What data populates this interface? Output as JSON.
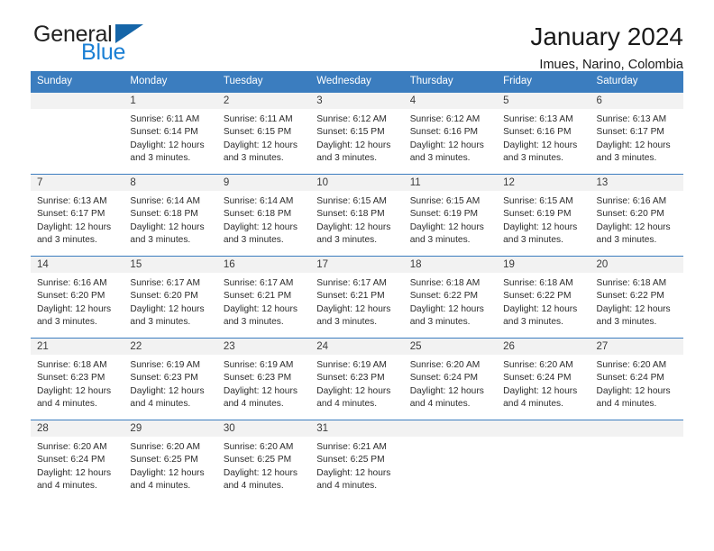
{
  "brand": {
    "name_part1": "General",
    "name_part2": "Blue",
    "triangle_icon": "triangle-icon",
    "accent_color": "#1a7fd4",
    "header_color": "#3b7dbf"
  },
  "header": {
    "title": "January 2024",
    "subtitle": "Imues, Narino, Colombia"
  },
  "weekday_headers": [
    "Sunday",
    "Monday",
    "Tuesday",
    "Wednesday",
    "Thursday",
    "Friday",
    "Saturday"
  ],
  "labels": {
    "sunrise": "Sunrise:",
    "sunset": "Sunset:",
    "daylight": "Daylight:"
  },
  "weeks": [
    [
      {
        "day": "",
        "empty": true,
        "sunrise": "",
        "sunset": "",
        "daylight_line1": "",
        "daylight_line2": ""
      },
      {
        "day": "1",
        "sunrise": "Sunrise: 6:11 AM",
        "sunset": "Sunset: 6:14 PM",
        "daylight_line1": "Daylight: 12 hours",
        "daylight_line2": "and 3 minutes."
      },
      {
        "day": "2",
        "sunrise": "Sunrise: 6:11 AM",
        "sunset": "Sunset: 6:15 PM",
        "daylight_line1": "Daylight: 12 hours",
        "daylight_line2": "and 3 minutes."
      },
      {
        "day": "3",
        "sunrise": "Sunrise: 6:12 AM",
        "sunset": "Sunset: 6:15 PM",
        "daylight_line1": "Daylight: 12 hours",
        "daylight_line2": "and 3 minutes."
      },
      {
        "day": "4",
        "sunrise": "Sunrise: 6:12 AM",
        "sunset": "Sunset: 6:16 PM",
        "daylight_line1": "Daylight: 12 hours",
        "daylight_line2": "and 3 minutes."
      },
      {
        "day": "5",
        "sunrise": "Sunrise: 6:13 AM",
        "sunset": "Sunset: 6:16 PM",
        "daylight_line1": "Daylight: 12 hours",
        "daylight_line2": "and 3 minutes."
      },
      {
        "day": "6",
        "sunrise": "Sunrise: 6:13 AM",
        "sunset": "Sunset: 6:17 PM",
        "daylight_line1": "Daylight: 12 hours",
        "daylight_line2": "and 3 minutes."
      }
    ],
    [
      {
        "day": "7",
        "sunrise": "Sunrise: 6:13 AM",
        "sunset": "Sunset: 6:17 PM",
        "daylight_line1": "Daylight: 12 hours",
        "daylight_line2": "and 3 minutes."
      },
      {
        "day": "8",
        "sunrise": "Sunrise: 6:14 AM",
        "sunset": "Sunset: 6:18 PM",
        "daylight_line1": "Daylight: 12 hours",
        "daylight_line2": "and 3 minutes."
      },
      {
        "day": "9",
        "sunrise": "Sunrise: 6:14 AM",
        "sunset": "Sunset: 6:18 PM",
        "daylight_line1": "Daylight: 12 hours",
        "daylight_line2": "and 3 minutes."
      },
      {
        "day": "10",
        "sunrise": "Sunrise: 6:15 AM",
        "sunset": "Sunset: 6:18 PM",
        "daylight_line1": "Daylight: 12 hours",
        "daylight_line2": "and 3 minutes."
      },
      {
        "day": "11",
        "sunrise": "Sunrise: 6:15 AM",
        "sunset": "Sunset: 6:19 PM",
        "daylight_line1": "Daylight: 12 hours",
        "daylight_line2": "and 3 minutes."
      },
      {
        "day": "12",
        "sunrise": "Sunrise: 6:15 AM",
        "sunset": "Sunset: 6:19 PM",
        "daylight_line1": "Daylight: 12 hours",
        "daylight_line2": "and 3 minutes."
      },
      {
        "day": "13",
        "sunrise": "Sunrise: 6:16 AM",
        "sunset": "Sunset: 6:20 PM",
        "daylight_line1": "Daylight: 12 hours",
        "daylight_line2": "and 3 minutes."
      }
    ],
    [
      {
        "day": "14",
        "sunrise": "Sunrise: 6:16 AM",
        "sunset": "Sunset: 6:20 PM",
        "daylight_line1": "Daylight: 12 hours",
        "daylight_line2": "and 3 minutes."
      },
      {
        "day": "15",
        "sunrise": "Sunrise: 6:17 AM",
        "sunset": "Sunset: 6:20 PM",
        "daylight_line1": "Daylight: 12 hours",
        "daylight_line2": "and 3 minutes."
      },
      {
        "day": "16",
        "sunrise": "Sunrise: 6:17 AM",
        "sunset": "Sunset: 6:21 PM",
        "daylight_line1": "Daylight: 12 hours",
        "daylight_line2": "and 3 minutes."
      },
      {
        "day": "17",
        "sunrise": "Sunrise: 6:17 AM",
        "sunset": "Sunset: 6:21 PM",
        "daylight_line1": "Daylight: 12 hours",
        "daylight_line2": "and 3 minutes."
      },
      {
        "day": "18",
        "sunrise": "Sunrise: 6:18 AM",
        "sunset": "Sunset: 6:22 PM",
        "daylight_line1": "Daylight: 12 hours",
        "daylight_line2": "and 3 minutes."
      },
      {
        "day": "19",
        "sunrise": "Sunrise: 6:18 AM",
        "sunset": "Sunset: 6:22 PM",
        "daylight_line1": "Daylight: 12 hours",
        "daylight_line2": "and 3 minutes."
      },
      {
        "day": "20",
        "sunrise": "Sunrise: 6:18 AM",
        "sunset": "Sunset: 6:22 PM",
        "daylight_line1": "Daylight: 12 hours",
        "daylight_line2": "and 3 minutes."
      }
    ],
    [
      {
        "day": "21",
        "sunrise": "Sunrise: 6:18 AM",
        "sunset": "Sunset: 6:23 PM",
        "daylight_line1": "Daylight: 12 hours",
        "daylight_line2": "and 4 minutes."
      },
      {
        "day": "22",
        "sunrise": "Sunrise: 6:19 AM",
        "sunset": "Sunset: 6:23 PM",
        "daylight_line1": "Daylight: 12 hours",
        "daylight_line2": "and 4 minutes."
      },
      {
        "day": "23",
        "sunrise": "Sunrise: 6:19 AM",
        "sunset": "Sunset: 6:23 PM",
        "daylight_line1": "Daylight: 12 hours",
        "daylight_line2": "and 4 minutes."
      },
      {
        "day": "24",
        "sunrise": "Sunrise: 6:19 AM",
        "sunset": "Sunset: 6:23 PM",
        "daylight_line1": "Daylight: 12 hours",
        "daylight_line2": "and 4 minutes."
      },
      {
        "day": "25",
        "sunrise": "Sunrise: 6:20 AM",
        "sunset": "Sunset: 6:24 PM",
        "daylight_line1": "Daylight: 12 hours",
        "daylight_line2": "and 4 minutes."
      },
      {
        "day": "26",
        "sunrise": "Sunrise: 6:20 AM",
        "sunset": "Sunset: 6:24 PM",
        "daylight_line1": "Daylight: 12 hours",
        "daylight_line2": "and 4 minutes."
      },
      {
        "day": "27",
        "sunrise": "Sunrise: 6:20 AM",
        "sunset": "Sunset: 6:24 PM",
        "daylight_line1": "Daylight: 12 hours",
        "daylight_line2": "and 4 minutes."
      }
    ],
    [
      {
        "day": "28",
        "sunrise": "Sunrise: 6:20 AM",
        "sunset": "Sunset: 6:24 PM",
        "daylight_line1": "Daylight: 12 hours",
        "daylight_line2": "and 4 minutes."
      },
      {
        "day": "29",
        "sunrise": "Sunrise: 6:20 AM",
        "sunset": "Sunset: 6:25 PM",
        "daylight_line1": "Daylight: 12 hours",
        "daylight_line2": "and 4 minutes."
      },
      {
        "day": "30",
        "sunrise": "Sunrise: 6:20 AM",
        "sunset": "Sunset: 6:25 PM",
        "daylight_line1": "Daylight: 12 hours",
        "daylight_line2": "and 4 minutes."
      },
      {
        "day": "31",
        "sunrise": "Sunrise: 6:21 AM",
        "sunset": "Sunset: 6:25 PM",
        "daylight_line1": "Daylight: 12 hours",
        "daylight_line2": "and 4 minutes."
      },
      {
        "day": "",
        "empty": true,
        "sunrise": "",
        "sunset": "",
        "daylight_line1": "",
        "daylight_line2": ""
      },
      {
        "day": "",
        "empty": true,
        "sunrise": "",
        "sunset": "",
        "daylight_line1": "",
        "daylight_line2": ""
      },
      {
        "day": "",
        "empty": true,
        "sunrise": "",
        "sunset": "",
        "daylight_line1": "",
        "daylight_line2": ""
      }
    ]
  ]
}
